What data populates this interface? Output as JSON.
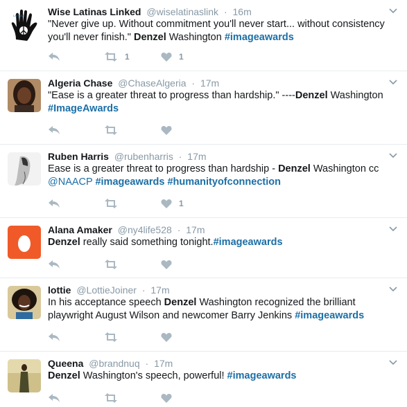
{
  "tweets": [
    {
      "name": "Wise Latinas Linked",
      "handle": "@wiselatinaslink",
      "separator": "·",
      "time": "16m",
      "body": [
        {
          "t": "text",
          "v": "\"Never give up. Without commitment you'll never start... without consistency you'll never finish.\" "
        },
        {
          "t": "bold",
          "v": "Denzel"
        },
        {
          "t": "text",
          "v": " Washington "
        },
        {
          "t": "tag",
          "v": "#imageawards"
        }
      ],
      "retweet_count": "1",
      "like_count": "1",
      "avatar_logo_text": "LATINAS"
    },
    {
      "name": "Algeria Chase",
      "handle": "@ChaseAlgeria",
      "separator": "·",
      "time": "17m",
      "body": [
        {
          "t": "text",
          "v": "\"Ease is a greater threat to progress than hardship.\" ----"
        },
        {
          "t": "bold",
          "v": "Denzel"
        },
        {
          "t": "text",
          "v": " Washington "
        },
        {
          "t": "tag",
          "v": "#ImageAwards"
        }
      ],
      "retweet_count": "",
      "like_count": ""
    },
    {
      "name": "Ruben Harris",
      "handle": "@rubenharris",
      "separator": "·",
      "time": "17m",
      "body": [
        {
          "t": "text",
          "v": "Ease is a greater threat to progress than hardship - "
        },
        {
          "t": "bold",
          "v": "Denzel"
        },
        {
          "t": "text",
          "v": " Washington cc "
        },
        {
          "t": "link",
          "v": "@NAACP"
        },
        {
          "t": "text",
          "v": " "
        },
        {
          "t": "tag",
          "v": "#imageawards"
        },
        {
          "t": "text",
          "v": " "
        },
        {
          "t": "tag",
          "v": "#humanityofconnection"
        }
      ],
      "retweet_count": "",
      "like_count": "1"
    },
    {
      "name": "Alana Amaker",
      "handle": "@ny4life528",
      "separator": "·",
      "time": "17m",
      "body": [
        {
          "t": "bold",
          "v": "Denzel"
        },
        {
          "t": "text",
          "v": " really said something tonight."
        },
        {
          "t": "tag",
          "v": "#imageawards"
        }
      ],
      "retweet_count": "",
      "like_count": ""
    },
    {
      "name": "lottie",
      "handle": "@LottieJoiner",
      "separator": "·",
      "time": "17m",
      "body": [
        {
          "t": "text",
          "v": "In his acceptance speech "
        },
        {
          "t": "bold",
          "v": "Denzel"
        },
        {
          "t": "text",
          "v": " Washington recognized the brilliant playwright August Wilson and newcomer Barry Jenkins "
        },
        {
          "t": "tag",
          "v": "#imageawards"
        }
      ],
      "retweet_count": "",
      "like_count": ""
    },
    {
      "name": "Queena",
      "handle": "@brandnuq",
      "separator": "·",
      "time": "17m",
      "body": [
        {
          "t": "bold",
          "v": "Denzel"
        },
        {
          "t": "text",
          "v": " Washington's speech, powerful! "
        },
        {
          "t": "tag",
          "v": "#imageawards"
        }
      ],
      "retweet_count": "",
      "like_count": ""
    }
  ],
  "colors": {
    "hashtag": "#1b6fa6",
    "meta": "#8899a6",
    "icon": "#aab8c2",
    "divider": "#e6ecf0",
    "egg_avatar": "#f05a28"
  },
  "icons": [
    "reply-icon",
    "retweet-icon",
    "like-icon",
    "chevron-down-icon",
    "egg-avatar"
  ]
}
